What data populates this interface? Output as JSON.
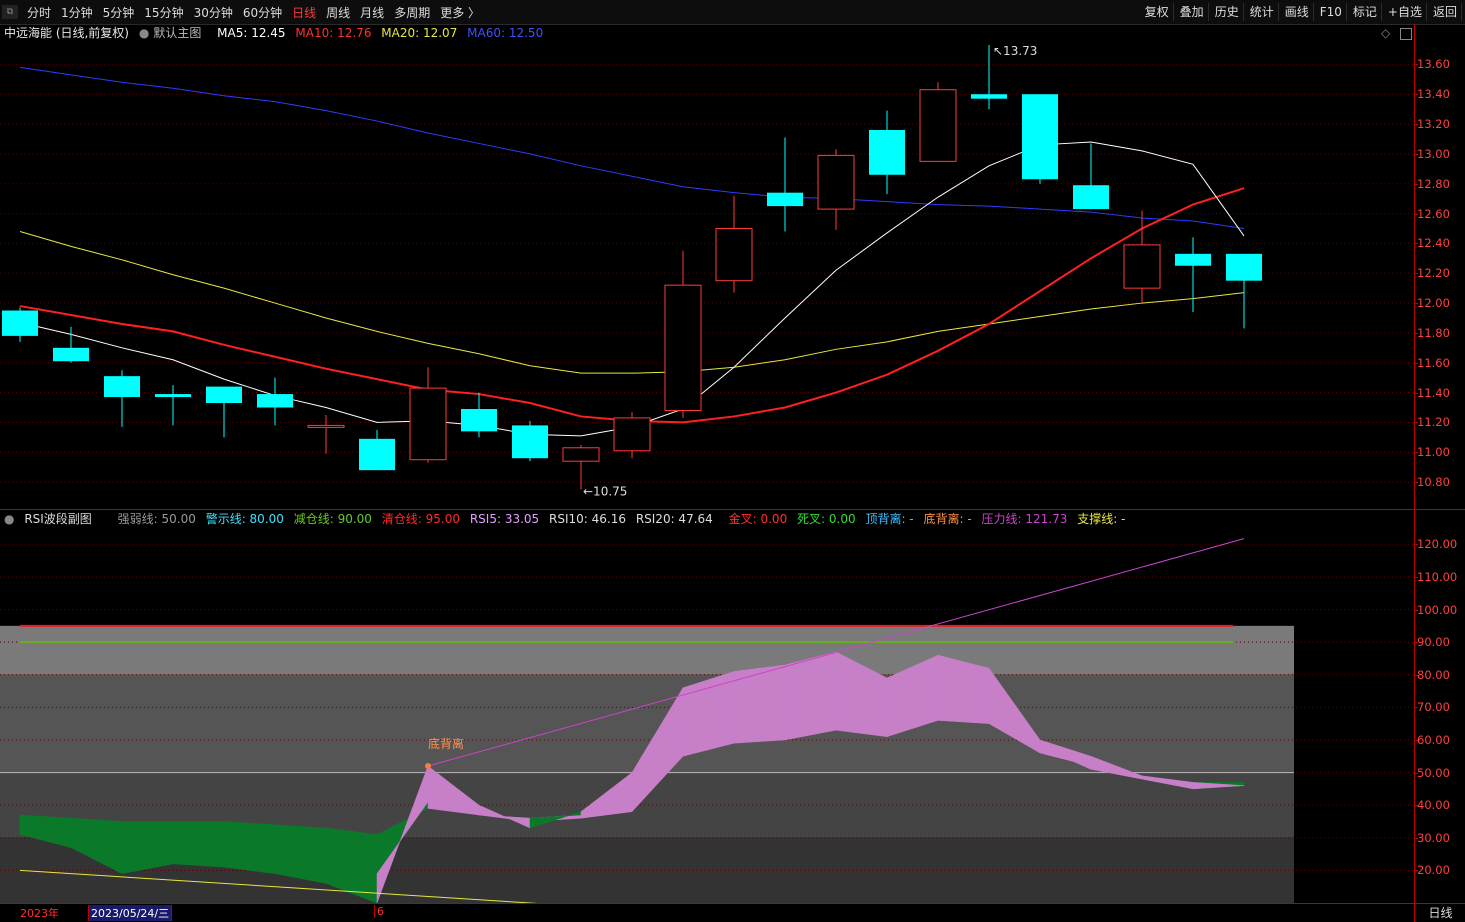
{
  "toolbar": {
    "periods": [
      "分时",
      "1分钟",
      "5分钟",
      "15分钟",
      "30分钟",
      "60分钟",
      "日线",
      "周线",
      "月线",
      "多周期",
      "更多 〉"
    ],
    "active_period": "日线",
    "right_buttons": [
      "复权",
      "叠加",
      "历史",
      "统计",
      "画线",
      "F10",
      "标记",
      "+自选",
      "返回"
    ]
  },
  "main": {
    "title": "中远海能 (日线,前复权)",
    "template": "默认主图",
    "ma5": "MA5: 12.45",
    "ma10": "MA10: 12.76",
    "ma20": "MA20: 12.07",
    "ma60": "MA60: 12.50",
    "high_label": "13.73",
    "low_label": "10.75",
    "y_ticks": [
      "13.60",
      "13.40",
      "13.20",
      "13.00",
      "12.80",
      "12.60",
      "12.40",
      "12.20",
      "12.00",
      "11.80",
      "11.60",
      "11.40",
      "11.20",
      "11.00",
      "10.80"
    ]
  },
  "sub": {
    "title": "RSI波段副图",
    "qrx": "强弱线: 50.00",
    "jsx": "警示线: 80.00",
    "jcx": "减仓线: 90.00",
    "qcx": "清仓线: 95.00",
    "rsi5": "RSI5: 33.05",
    "rsi10": "RSI10: 46.16",
    "rsi20": "RSI20: 47.64",
    "jc": "金叉: 0.00",
    "sc": "死叉: 0.00",
    "dbl": "顶背离: -",
    "dbl2": "底背离: -",
    "ylx": "压力线: 121.73",
    "zcx": "支撑线: -",
    "divergence_label": "底背离",
    "y_ticks": [
      "120.00",
      "110.00",
      "100.00",
      "90.00",
      "80.00",
      "70.00",
      "60.00",
      "50.00",
      "40.00",
      "30.00",
      "20.00"
    ]
  },
  "bottom": {
    "year": "2023年",
    "date": "2023/05/24/三",
    "month": "6",
    "period_label": "日线"
  },
  "colors": {
    "up": "#ff3b3b",
    "down": "#00ffff",
    "ma5": "#ffffff",
    "ma10": "#ff2020",
    "ma20": "#e8e840",
    "ma60": "#2f3cff",
    "rsi_up": "#c77fc8",
    "rsi_down": "#0a7a2a"
  },
  "chart_data": [
    {
      "type": "candlestick",
      "title": "中远海能 (日线,前复权)",
      "ylim": [
        10.7,
        13.75
      ],
      "candles": [
        {
          "o": 11.95,
          "h": 11.97,
          "l": 11.74,
          "c": 11.78
        },
        {
          "o": 11.7,
          "h": 11.84,
          "l": 11.6,
          "c": 11.61
        },
        {
          "o": 11.51,
          "h": 11.55,
          "l": 11.17,
          "c": 11.37
        },
        {
          "o": 11.39,
          "h": 11.45,
          "l": 11.18,
          "c": 11.37
        },
        {
          "o": 11.44,
          "h": 11.44,
          "l": 11.1,
          "c": 11.33
        },
        {
          "o": 11.39,
          "h": 11.5,
          "l": 11.18,
          "c": 11.3
        },
        {
          "o": 11.18,
          "h": 11.25,
          "l": 10.99,
          "c": 11.18
        },
        {
          "o": 11.09,
          "h": 11.15,
          "l": 10.88,
          "c": 10.88
        },
        {
          "o": 10.95,
          "h": 11.57,
          "l": 10.93,
          "c": 11.43
        },
        {
          "o": 11.29,
          "h": 11.4,
          "l": 11.1,
          "c": 11.14
        },
        {
          "o": 11.18,
          "h": 11.21,
          "l": 10.94,
          "c": 10.96
        },
        {
          "o": 10.94,
          "h": 11.05,
          "l": 10.75,
          "c": 11.03
        },
        {
          "o": 11.01,
          "h": 11.27,
          "l": 10.96,
          "c": 11.23
        },
        {
          "o": 11.28,
          "h": 12.35,
          "l": 11.23,
          "c": 12.12
        },
        {
          "o": 12.15,
          "h": 12.72,
          "l": 12.07,
          "c": 12.5
        },
        {
          "o": 12.74,
          "h": 13.11,
          "l": 12.48,
          "c": 12.65
        },
        {
          "o": 12.63,
          "h": 13.03,
          "l": 12.49,
          "c": 12.99
        },
        {
          "o": 13.16,
          "h": 13.29,
          "l": 12.73,
          "c": 12.86
        },
        {
          "o": 12.95,
          "h": 13.48,
          "l": 12.95,
          "c": 13.43
        },
        {
          "o": 13.4,
          "h": 13.73,
          "l": 13.3,
          "c": 13.37
        },
        {
          "o": 13.4,
          "h": 13.4,
          "l": 12.8,
          "c": 12.83
        },
        {
          "o": 12.79,
          "h": 13.07,
          "l": 12.63,
          "c": 12.63
        },
        {
          "o": 12.1,
          "h": 12.62,
          "l": 12.0,
          "c": 12.39
        },
        {
          "o": 12.33,
          "h": 12.44,
          "l": 11.94,
          "c": 12.25
        },
        {
          "o": 12.33,
          "h": 12.33,
          "l": 11.83,
          "c": 12.15
        }
      ],
      "ma5": [
        11.87,
        11.79,
        11.7,
        11.62,
        11.49,
        11.38,
        11.3,
        11.2,
        11.21,
        11.18,
        11.12,
        11.11,
        11.17,
        11.29,
        11.57,
        11.9,
        12.22,
        12.47,
        12.71,
        12.92,
        13.06,
        13.08,
        13.02,
        12.93,
        12.45
      ],
      "ma10": [
        11.98,
        11.92,
        11.86,
        11.81,
        11.72,
        11.64,
        11.56,
        11.49,
        11.42,
        11.39,
        11.33,
        11.24,
        11.21,
        11.2,
        11.24,
        11.3,
        11.4,
        11.52,
        11.68,
        11.86,
        12.08,
        12.3,
        12.5,
        12.66,
        12.77,
        12.78,
        12.76
      ],
      "ma20": [
        12.48,
        12.38,
        12.29,
        12.19,
        12.1,
        12.0,
        11.9,
        11.81,
        11.73,
        11.66,
        11.58,
        11.53,
        11.53,
        11.54,
        11.57,
        11.62,
        11.69,
        11.74,
        11.81,
        11.86,
        11.91,
        11.96,
        12.0,
        12.03,
        12.07
      ],
      "ma60": [
        13.58,
        13.53,
        13.48,
        13.44,
        13.39,
        13.35,
        13.29,
        13.22,
        13.14,
        13.07,
        13.0,
        12.92,
        12.85,
        12.78,
        12.74,
        12.71,
        12.7,
        12.68,
        12.66,
        12.65,
        12.63,
        12.61,
        12.57,
        12.55,
        12.5
      ]
    },
    {
      "type": "area",
      "title": "RSI波段副图",
      "ylim": [
        10,
        125
      ],
      "rsi5": [
        31,
        27,
        19,
        22,
        21,
        19,
        16,
        10,
        52,
        40,
        33,
        38,
        50,
        76,
        81,
        83,
        87,
        79,
        86,
        82,
        60,
        55,
        49,
        47,
        46
      ],
      "rsi10": [
        33,
        30,
        25,
        27,
        27,
        26,
        25,
        19,
        41,
        37,
        36,
        37,
        40,
        61,
        66,
        69,
        72,
        69,
        75,
        73,
        58,
        51,
        48,
        45,
        46
      ],
      "rsi20": [
        37,
        36,
        35,
        35,
        35,
        34,
        33,
        31,
        39,
        37,
        35,
        36,
        38,
        55,
        59,
        60,
        63,
        61,
        66,
        65,
        56,
        52,
        49,
        47,
        47
      ],
      "lines": {
        "strong_weak": 50,
        "warning": 80,
        "reduce": 90,
        "clear": 95
      },
      "pressure_line": [
        [
          8,
          52
        ],
        [
          24,
          121.73
        ]
      ],
      "support_line": [
        [
          0,
          20
        ],
        [
          12,
          8
        ]
      ]
    }
  ]
}
